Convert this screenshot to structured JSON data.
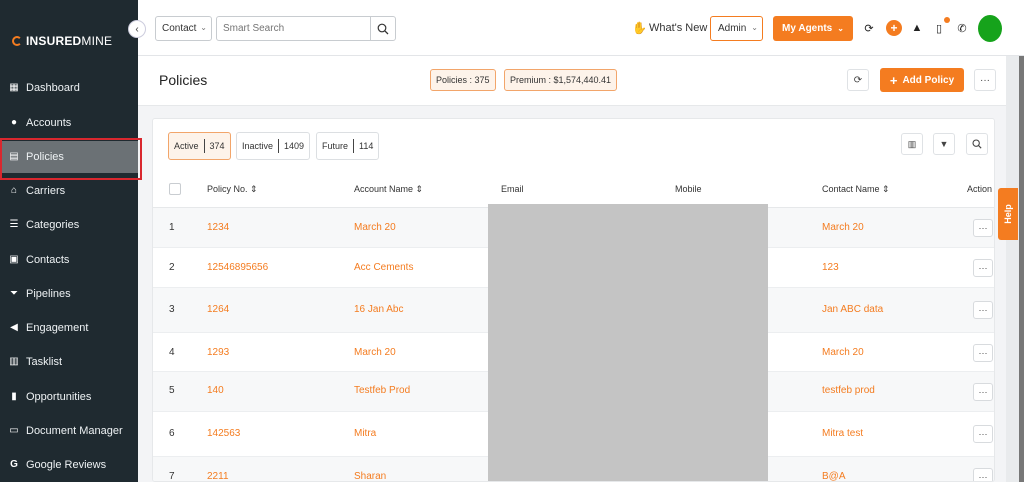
{
  "sidebar": {
    "logo_bold": "INSURED",
    "logo_light": "MINE",
    "items": [
      {
        "label": "Dashboard",
        "icon": "dashboard-icon"
      },
      {
        "label": "Accounts",
        "icon": "accounts-icon"
      },
      {
        "label": "Policies",
        "icon": "policies-icon",
        "active": true
      },
      {
        "label": "Carriers",
        "icon": "carriers-icon"
      },
      {
        "label": "Categories",
        "icon": "categories-icon"
      },
      {
        "label": "Contacts",
        "icon": "contacts-icon"
      },
      {
        "label": "Pipelines",
        "icon": "pipelines-icon"
      },
      {
        "label": "Engagement",
        "icon": "megaphone-icon"
      },
      {
        "label": "Tasklist",
        "icon": "tasklist-icon"
      },
      {
        "label": "Opportunities",
        "icon": "chart-icon"
      },
      {
        "label": "Document Manager",
        "icon": "folder-icon"
      },
      {
        "label": "Google Reviews",
        "icon": "google-icon"
      }
    ]
  },
  "topbar": {
    "search_type": "Contact",
    "search_placeholder": "Smart Search",
    "whats_new": "What's New",
    "role": "Admin",
    "agents_label": "My Agents",
    "accent": "#f47c20",
    "avatar_color": "#16a31b"
  },
  "page": {
    "title": "Policies",
    "policies_count": "Policies : 375",
    "premium": "Premium : $1,574,440.41",
    "add_policy": "Add Policy",
    "help": "Help"
  },
  "filters": [
    {
      "label": "Active",
      "count": "374",
      "active": true
    },
    {
      "label": "Inactive",
      "count": "1409"
    },
    {
      "label": "Future",
      "count": "114"
    }
  ],
  "table": {
    "columns": [
      "Policy No.",
      "Account Name",
      "Email",
      "Mobile",
      "Contact Name",
      "Action"
    ],
    "rows": [
      {
        "n": "1",
        "policy": "1234",
        "account": "March 20",
        "contact": "March 20"
      },
      {
        "n": "2",
        "policy": "12546895656",
        "account": "Acc Cements",
        "contact": "123"
      },
      {
        "n": "3",
        "policy": "1264",
        "account": "16 Jan Abc",
        "contact": "Jan ABC data"
      },
      {
        "n": "4",
        "policy": "1293",
        "account": "March 20",
        "contact": "March 20"
      },
      {
        "n": "5",
        "policy": "140",
        "account": "Testfeb Prod",
        "contact": "testfeb prod"
      },
      {
        "n": "6",
        "policy": "142563",
        "account": "Mitra",
        "contact": "Mitra test"
      },
      {
        "n": "7",
        "policy": "2211",
        "account": "Sharan",
        "contact": "B@A"
      }
    ]
  }
}
